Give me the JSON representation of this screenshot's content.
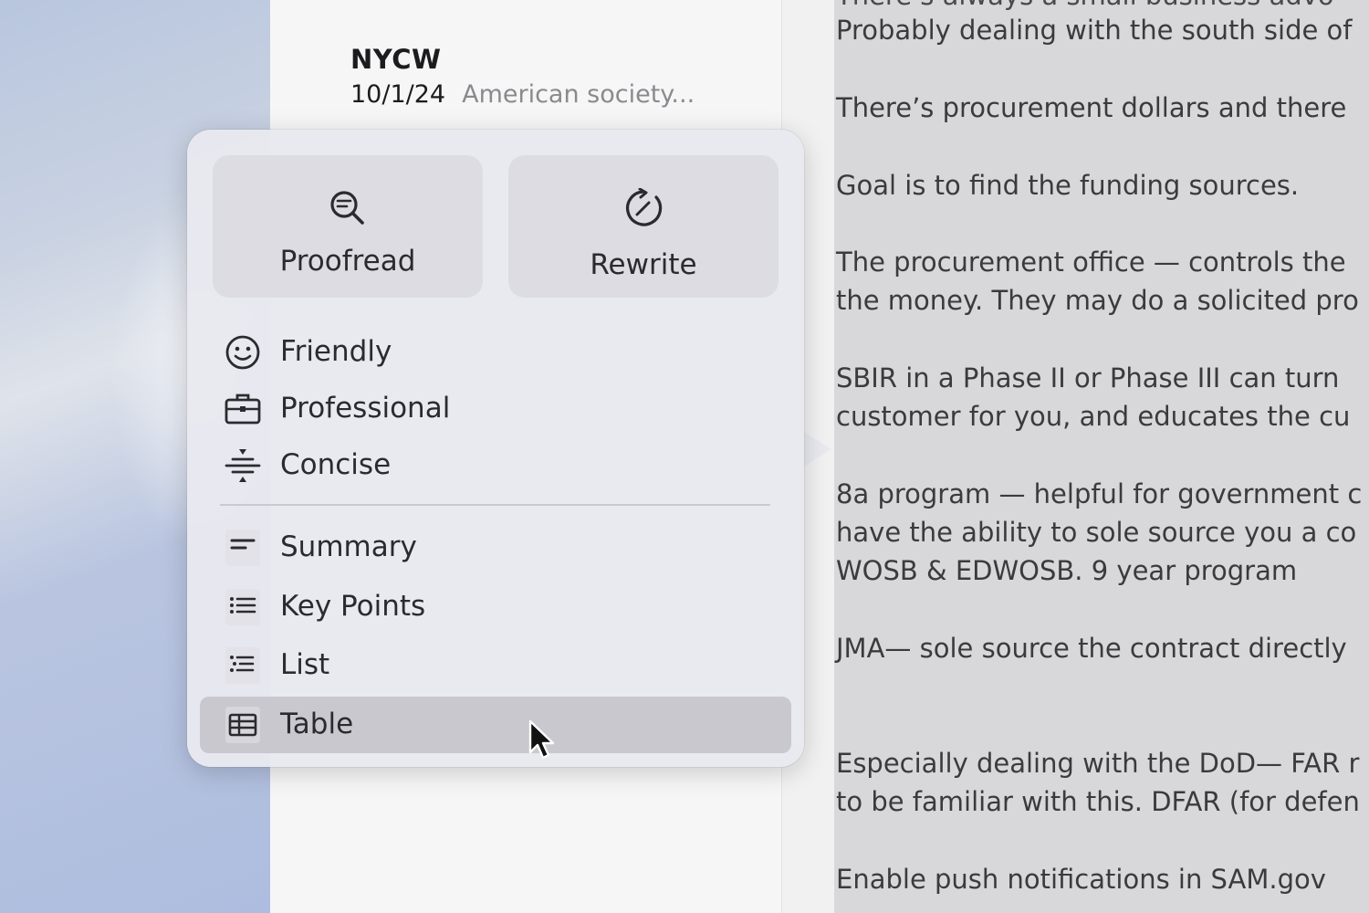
{
  "notes_list": {
    "title": "NYCW",
    "date": "10/1/24",
    "preview": "American society..."
  },
  "content": {
    "lines": [
      "Probably dealing with the south side of",
      "There’s procurement dollars and there",
      "Goal is to find the funding sources.",
      "The procurement office — controls the",
      "the money. They may do a solicited pro",
      "SBIR in a Phase II or Phase III can turn",
      "customer for you, and educates the cu",
      "8a program — helpful for government c",
      "have the ability to sole source you a co",
      "WOSB & EDWOSB. 9 year program",
      "JMA— sole source the contract directly",
      "Especially dealing with the DoD— FAR r",
      "to be familiar with this. DFAR (for defen",
      "Enable push notifications in SAM.gov"
    ]
  },
  "writing_tools": {
    "proofread_label": "Proofread",
    "rewrite_label": "Rewrite",
    "tone_items": [
      {
        "label": "Friendly",
        "icon": "smiley-icon"
      },
      {
        "label": "Professional",
        "icon": "briefcase-icon"
      },
      {
        "label": "Concise",
        "icon": "compress-icon"
      }
    ],
    "format_items": [
      {
        "label": "Summary",
        "icon": "summary-icon"
      },
      {
        "label": "Key Points",
        "icon": "bullet-list-icon"
      },
      {
        "label": "List",
        "icon": "list-icon"
      },
      {
        "label": "Table",
        "icon": "table-icon"
      }
    ],
    "selected_item": "Table"
  },
  "colors": {
    "popover_bg": "#e8e8f0",
    "selected_bg": "#c8c8ce",
    "text": "#2b2b2f"
  }
}
